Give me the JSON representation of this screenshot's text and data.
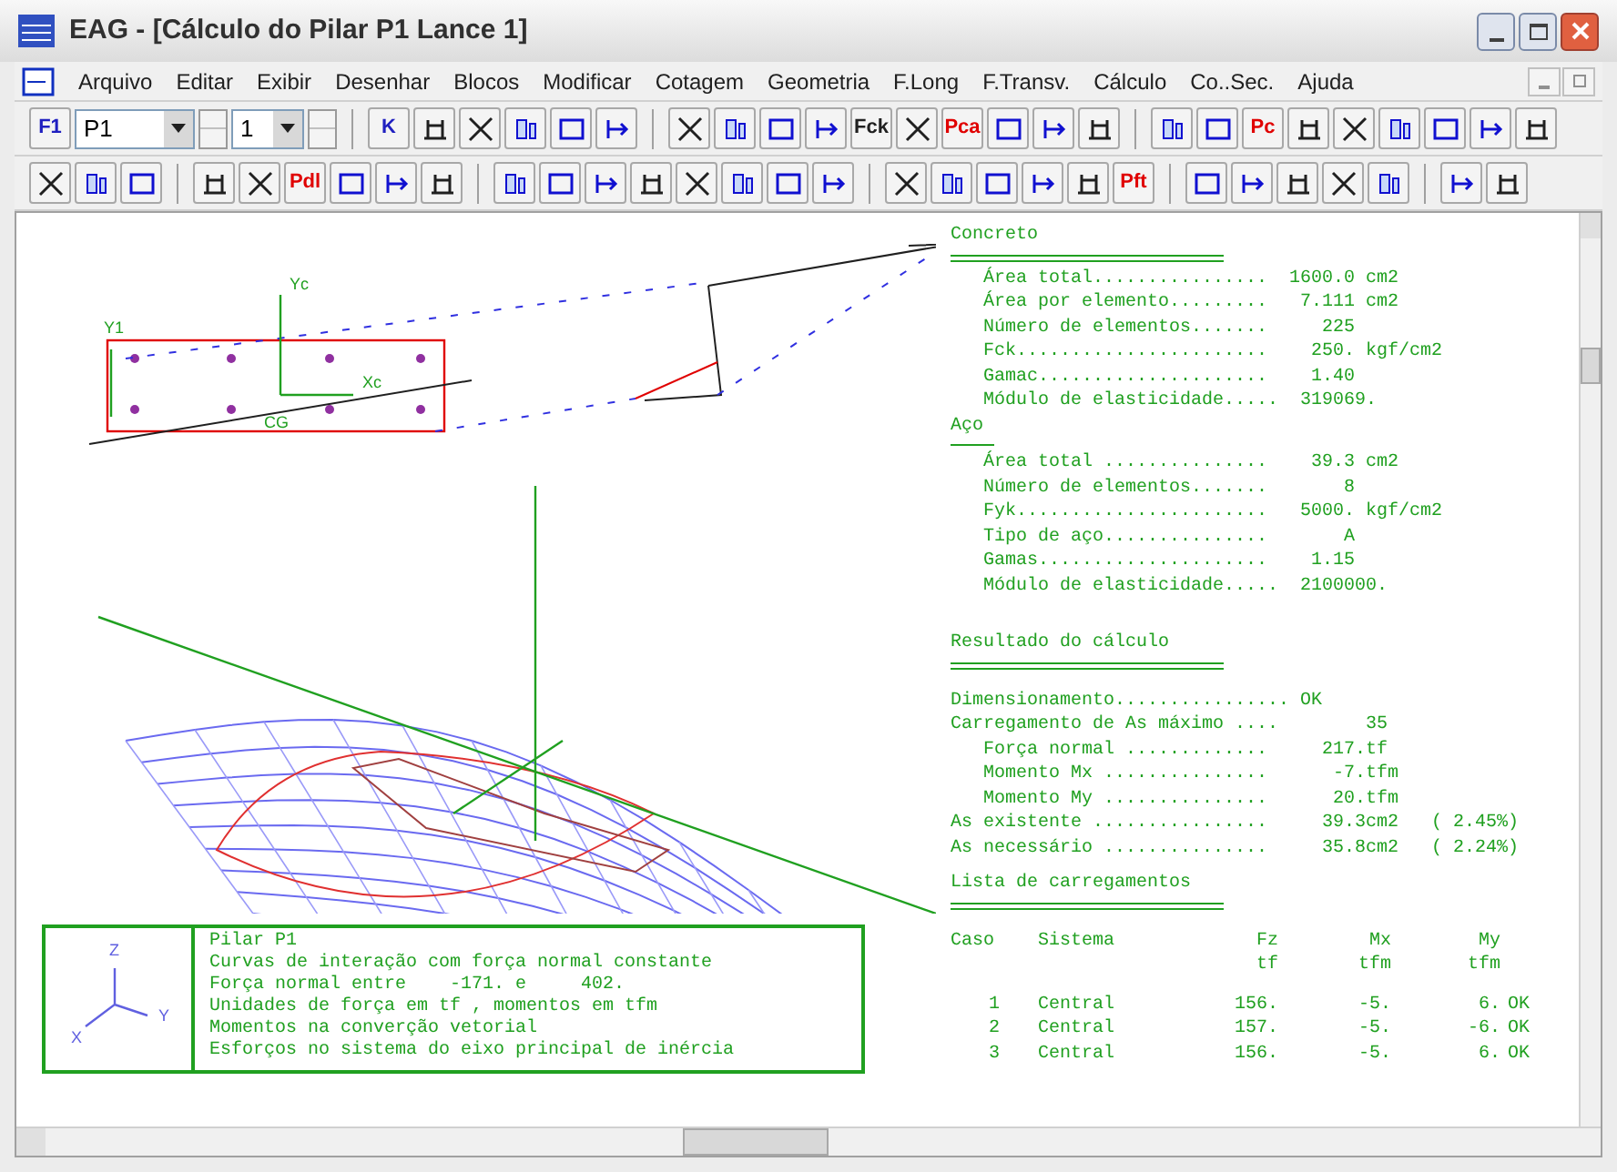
{
  "window": {
    "title": "EAG - [Cálculo do Pilar P1 Lance 1]"
  },
  "menu": [
    "Arquivo",
    "Editar",
    "Exibir",
    "Desenhar",
    "Blocos",
    "Modificar",
    "Cotagem",
    "Geometria",
    "F.Long",
    "F.Transv.",
    "Cálculo",
    "Co..Sec.",
    "Ajuda"
  ],
  "toolbars": [
    [
      {
        "kind": "button",
        "label": "F1",
        "color": "#2020c0"
      },
      {
        "kind": "combo",
        "value": "P1"
      },
      {
        "kind": "spin"
      },
      {
        "kind": "combo",
        "value": "1"
      },
      {
        "kind": "spin"
      },
      {
        "kind": "sep"
      },
      {
        "kind": "button",
        "label": "K",
        "color": "#2020c0"
      },
      {
        "kind": "button"
      },
      {
        "kind": "button"
      },
      {
        "kind": "button"
      },
      {
        "kind": "button"
      },
      {
        "kind": "button"
      },
      {
        "kind": "sep"
      },
      {
        "kind": "button"
      },
      {
        "kind": "button"
      },
      {
        "kind": "button"
      },
      {
        "kind": "button"
      },
      {
        "kind": "button",
        "label": "Fck",
        "color": "#202020"
      },
      {
        "kind": "button"
      },
      {
        "kind": "button",
        "label": "Pca",
        "color": "#e00000"
      },
      {
        "kind": "button"
      },
      {
        "kind": "button"
      },
      {
        "kind": "button"
      },
      {
        "kind": "sep"
      },
      {
        "kind": "button"
      },
      {
        "kind": "button"
      },
      {
        "kind": "button",
        "label": "Pc",
        "color": "#e00000"
      },
      {
        "kind": "button"
      },
      {
        "kind": "button"
      },
      {
        "kind": "button"
      },
      {
        "kind": "button"
      },
      {
        "kind": "button"
      },
      {
        "kind": "button"
      }
    ],
    [
      {
        "kind": "button"
      },
      {
        "kind": "button"
      },
      {
        "kind": "button"
      },
      {
        "kind": "sep"
      },
      {
        "kind": "button"
      },
      {
        "kind": "button"
      },
      {
        "kind": "button",
        "label": "Pdl",
        "color": "#e00000"
      },
      {
        "kind": "button"
      },
      {
        "kind": "button"
      },
      {
        "kind": "button"
      },
      {
        "kind": "sep"
      },
      {
        "kind": "button"
      },
      {
        "kind": "button"
      },
      {
        "kind": "button"
      },
      {
        "kind": "button"
      },
      {
        "kind": "button"
      },
      {
        "kind": "button"
      },
      {
        "kind": "button"
      },
      {
        "kind": "button"
      },
      {
        "kind": "sep"
      },
      {
        "kind": "button"
      },
      {
        "kind": "button"
      },
      {
        "kind": "button"
      },
      {
        "kind": "button"
      },
      {
        "kind": "button"
      },
      {
        "kind": "button",
        "label": "Pft",
        "color": "#e00000"
      },
      {
        "kind": "sep"
      },
      {
        "kind": "button"
      },
      {
        "kind": "button"
      },
      {
        "kind": "button"
      },
      {
        "kind": "button"
      },
      {
        "kind": "button"
      },
      {
        "kind": "sep"
      },
      {
        "kind": "button"
      },
      {
        "kind": "button"
      }
    ]
  ],
  "diagram": {
    "labels": [
      "Yc",
      "Y1",
      "Xc",
      "CG"
    ]
  },
  "legend": {
    "axes": [
      "Z",
      "Y",
      "X"
    ],
    "lines": [
      "Pilar P1",
      "Curvas de interação com força normal constante",
      "Força normal entre    -171. e     402.",
      "Unidades de força em tf , momentos em tfm",
      "Momentos na converção vetorial",
      "Esforços no sistema do eixo principal de inércia"
    ]
  },
  "report": {
    "sections": [
      {
        "title": "Concreto",
        "lines": [
          "   Área total................  1600.0 cm2",
          "   Área por elemento.........   7.111 cm2",
          "   Número de elementos.......     225",
          "   Fck.......................    250. kgf/cm2",
          "   Gamac.....................    1.40",
          "   Módulo de elasticidade.....  319069."
        ]
      },
      {
        "title": "Aço",
        "lines": [
          "   Área total ...............    39.3 cm2",
          "   Número de elementos.......       8",
          "   Fyk.......................   5000. kgf/cm2",
          "   Tipo de aço...............       A",
          "   Gamas.....................    1.15",
          "   Módulo de elasticidade.....  2100000."
        ]
      },
      {
        "title": "Resultado do cálculo",
        "lines": [
          "Dimensionamento................ OK",
          "Carregamento de As máximo ....        35",
          "   Força normal .............     217.tf",
          "   Momento Mx ...............      -7.tfm",
          "   Momento My ...............      20.tfm",
          "As existente ................     39.3cm2   ( 2.45%)",
          "As necessário ...............     35.8cm2   ( 2.24%)"
        ]
      },
      {
        "title": "Lista de carregamentos"
      }
    ],
    "table": {
      "columns": [
        "Caso",
        "Sistema",
        "Fz",
        "Mx",
        "My"
      ],
      "units": [
        "tf",
        "tfm",
        "tfm"
      ],
      "rows": [
        [
          "1",
          "Central",
          "156.",
          "-5.",
          "6.",
          "OK"
        ],
        [
          "2",
          "Central",
          "157.",
          "-5.",
          "-6.",
          "OK"
        ],
        [
          "3",
          "Central",
          "156.",
          "-5.",
          "6.",
          "OK"
        ]
      ]
    }
  }
}
